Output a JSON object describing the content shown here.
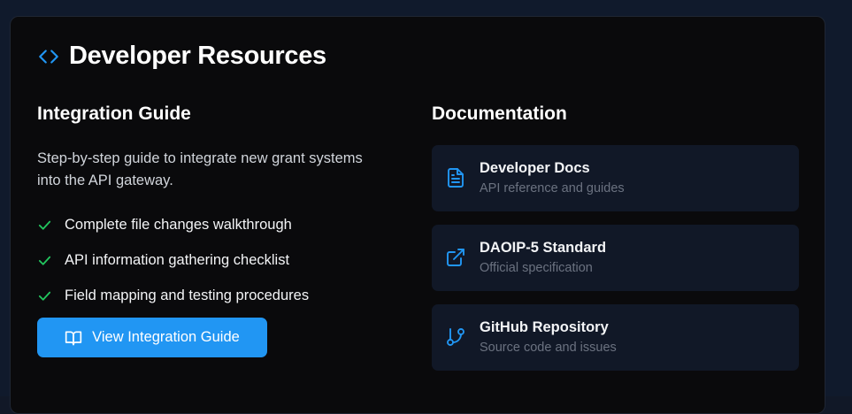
{
  "panel": {
    "title": "Developer Resources",
    "title_icon": "code-brackets-icon"
  },
  "integration_guide": {
    "heading": "Integration Guide",
    "description": "Step-by-step guide to integrate new grant systems into the API gateway.",
    "checklist": [
      {
        "label": "Complete file changes walkthrough",
        "icon": "check-icon"
      },
      {
        "label": "API information gathering checklist",
        "icon": "check-icon"
      },
      {
        "label": "Field mapping and testing procedures",
        "icon": "check-icon"
      }
    ],
    "button_label": "View Integration Guide",
    "button_icon": "book-open-icon"
  },
  "documentation": {
    "heading": "Documentation",
    "cards": [
      {
        "title": "Developer Docs",
        "subtitle": "API reference and guides",
        "icon": "file-text-icon"
      },
      {
        "title": "DAOIP-5 Standard",
        "subtitle": "Official specification",
        "icon": "external-link-icon"
      },
      {
        "title": "GitHub Repository",
        "subtitle": "Source code and issues",
        "icon": "git-branch-icon"
      }
    ]
  },
  "colors": {
    "accent": "#2196f3",
    "check": "#22c55e",
    "panel_bg": "#0a0a0c",
    "card_bg": "#111827"
  }
}
